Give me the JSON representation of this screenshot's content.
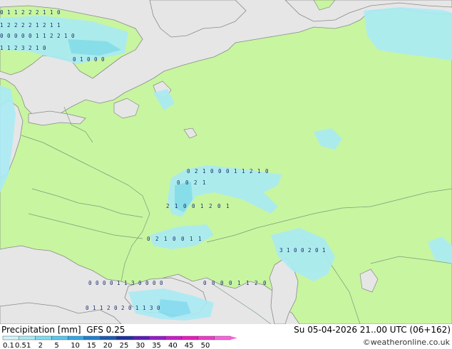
{
  "title": {
    "label": "Precipitation [mm]",
    "model": "GFS 0.25"
  },
  "run": {
    "day": "Su",
    "date": "05-04-2026",
    "time": "21..00 UTC",
    "lead": "(06+162)"
  },
  "credit": "©weatheronline.co.uk",
  "legend": {
    "values": [
      "0.1",
      "0.5",
      "1",
      "2",
      "5",
      "10",
      "15",
      "20",
      "25",
      "30",
      "35",
      "40",
      "45",
      "50"
    ],
    "colors": [
      "#d2f5fa",
      "#aaebf5",
      "#82dcf0",
      "#5ac8eb",
      "#32aae6",
      "#1e82d2",
      "#1e5ab4",
      "#1e32a0",
      "#5a1eb4",
      "#961ec8",
      "#c81ec8",
      "#e61ebe",
      "#f03cc8",
      "#fa64dc"
    ]
  },
  "colors": {
    "land": "#c8f5a0",
    "sea": "#e6e6e6",
    "border": "#7c9a7c",
    "coast": "#8a8a8a"
  },
  "precip_rows": [
    [
      "0",
      "1",
      "1",
      "2",
      "2",
      "2",
      "1",
      "1",
      "0"
    ],
    [
      "1",
      "2",
      "2",
      "2",
      "2",
      "1",
      "2",
      "1",
      "1"
    ],
    [
      "0",
      "0",
      "0",
      "0",
      "0",
      "1",
      "1",
      "2",
      "2",
      "1",
      "0"
    ],
    [
      "1",
      "1",
      "2",
      "3",
      "2",
      "1",
      "0"
    ],
    [
      "0",
      "1",
      "0",
      "0",
      "0"
    ],
    [
      "0",
      "2",
      "1",
      "0",
      "0",
      "0",
      "1",
      "1",
      "2",
      "1",
      "0"
    ],
    [
      "0",
      "0",
      "2",
      "1"
    ],
    [
      "0",
      "2",
      "1",
      "0",
      "0",
      "1",
      "1"
    ],
    [
      "2",
      "1",
      "0",
      "0",
      "1",
      "2",
      "0",
      "1"
    ],
    [
      "3",
      "1",
      "0",
      "0",
      "2",
      "0",
      "1"
    ],
    [
      "0",
      "1",
      "1",
      "2",
      "0",
      "2",
      "0",
      "1",
      "1",
      "3",
      "0"
    ],
    [
      "0",
      "0",
      "0",
      "0",
      "1",
      "1",
      "3",
      "0",
      "0",
      "0",
      "0"
    ],
    [
      "0",
      "0",
      "0",
      "0",
      "1",
      "1",
      "2",
      "0"
    ]
  ]
}
